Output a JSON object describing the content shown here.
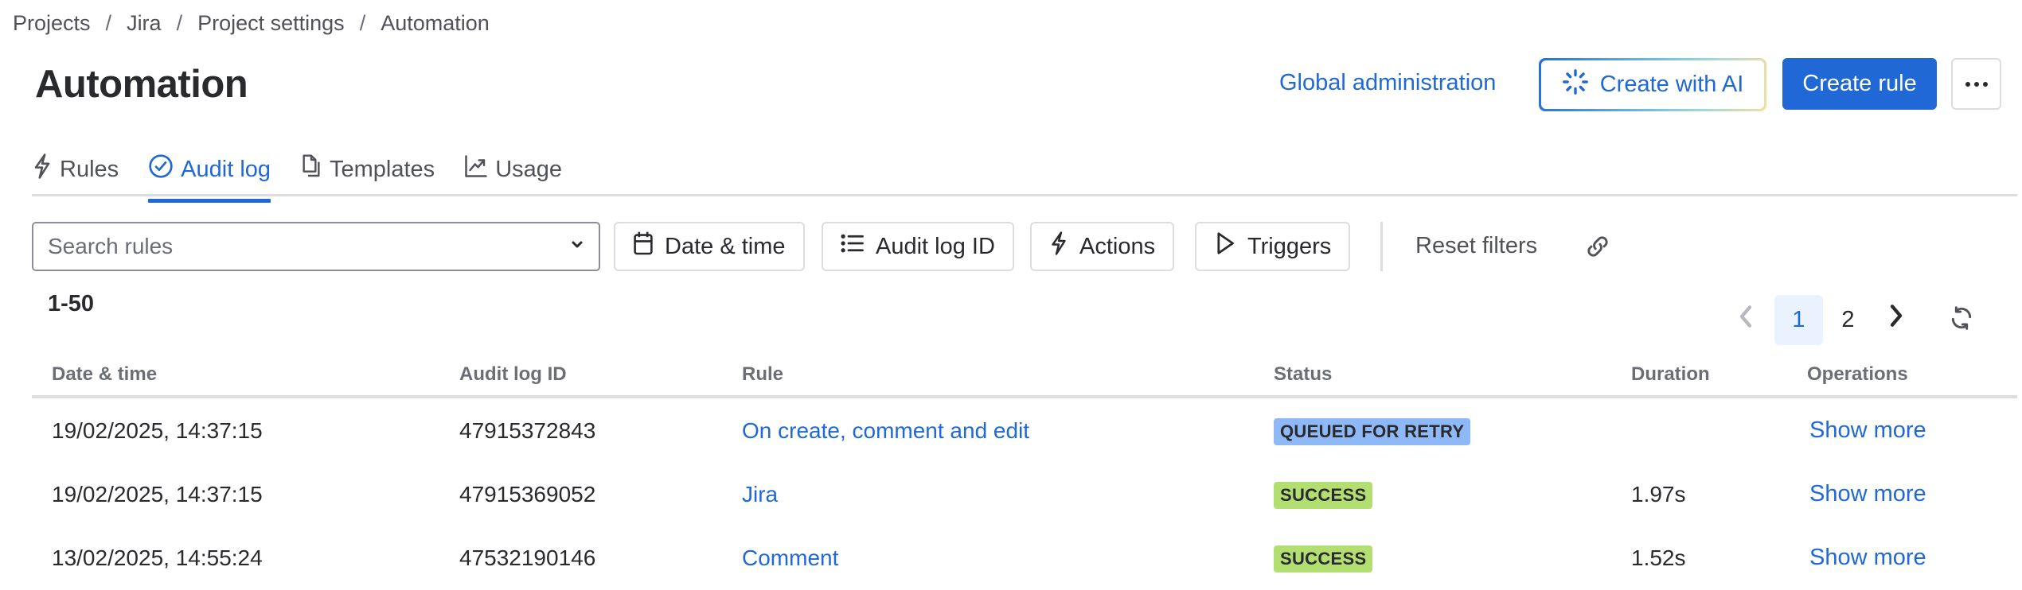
{
  "breadcrumb": [
    "Projects",
    "Jira",
    "Project settings",
    "Automation"
  ],
  "breadcrumb_separator": "/",
  "header": {
    "title": "Automation",
    "global_admin_label": "Global administration",
    "create_ai_label": "Create with AI",
    "create_rule_label": "Create rule",
    "more_icon": "more-horizontal-icon"
  },
  "tabs": [
    {
      "label": "Rules",
      "icon": "lightning-icon",
      "active": false
    },
    {
      "label": "Audit log",
      "icon": "check-circle-icon",
      "active": true
    },
    {
      "label": "Templates",
      "icon": "copy-document-icon",
      "active": false
    },
    {
      "label": "Usage",
      "icon": "line-chart-icon",
      "active": false
    }
  ],
  "filters": {
    "search_placeholder": "Search rules",
    "date_time_label": "Date & time",
    "audit_log_id_label": "Audit log ID",
    "actions_label": "Actions",
    "triggers_label": "Triggers",
    "reset_label": "Reset filters"
  },
  "results": {
    "range": "1-50"
  },
  "pagination": {
    "pages": [
      "1",
      "2"
    ],
    "current": "1"
  },
  "table": {
    "columns": [
      "Date & time",
      "Audit log ID",
      "Rule",
      "Status",
      "Duration",
      "Operations"
    ],
    "rows": [
      {
        "date": "19/02/2025, 14:37:15",
        "id": "47915372843",
        "rule": "On create, comment and edit",
        "status": "QUEUED FOR RETRY",
        "status_color": "#8fb8f6",
        "duration": "",
        "operation": "Show more"
      },
      {
        "date": "19/02/2025, 14:37:15",
        "id": "47915369052",
        "rule": "Jira",
        "status": "SUCCESS",
        "status_color": "#b3df72",
        "duration": "1.97s",
        "operation": "Show more"
      },
      {
        "date": "13/02/2025, 14:55:24",
        "id": "47532190146",
        "rule": "Comment",
        "status": "SUCCESS",
        "status_color": "#b3df72",
        "duration": "1.52s",
        "operation": "Show more"
      }
    ]
  },
  "colors": {
    "brand": "#1f68d6",
    "text": "#292a2e",
    "subtle": "#505258",
    "border": "#dcdde0"
  }
}
